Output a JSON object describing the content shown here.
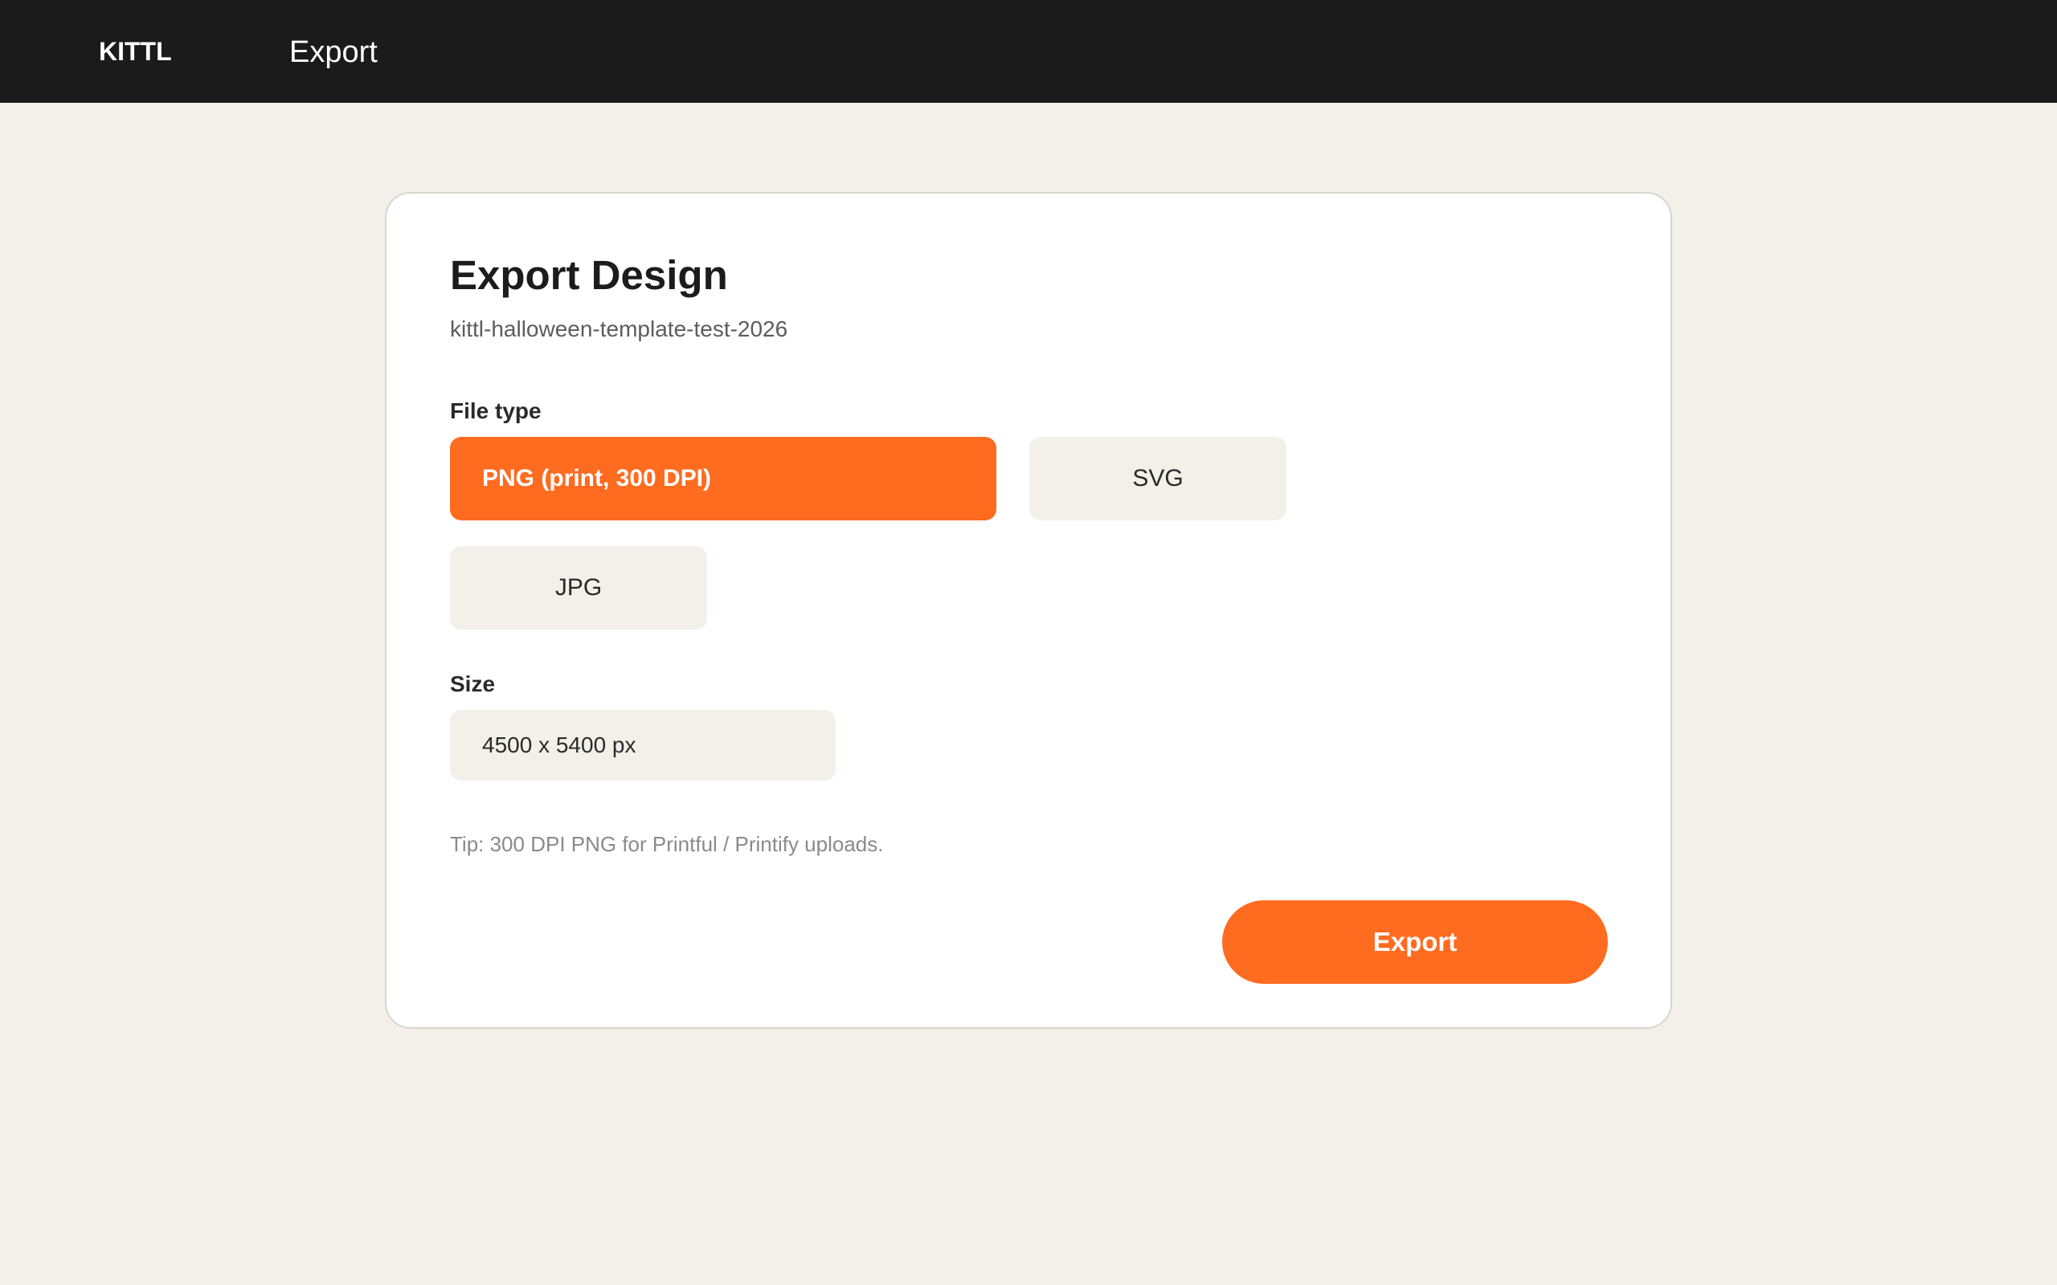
{
  "topbar": {
    "brand": "KITTL",
    "title": "Export"
  },
  "dialog": {
    "title": "Export Design",
    "filename": "kittl-halloween-template-test-2026",
    "file_type_label": "File type",
    "file_types": [
      {
        "label": "PNG (print, 300 DPI)",
        "selected": true
      },
      {
        "label": "SVG",
        "selected": false
      },
      {
        "label": "JPG",
        "selected": false
      }
    ],
    "size_label": "Size",
    "size_value": "4500 x 5400 px",
    "tip": "Tip: 300 DPI PNG for Printful / Printify uploads.",
    "export_label": "Export"
  },
  "colors": {
    "topbar_bg": "#1b1b1b",
    "page_bg": "#f3f0e9",
    "accent": "#ff6b1f",
    "option_bg": "#f3f0e9"
  }
}
